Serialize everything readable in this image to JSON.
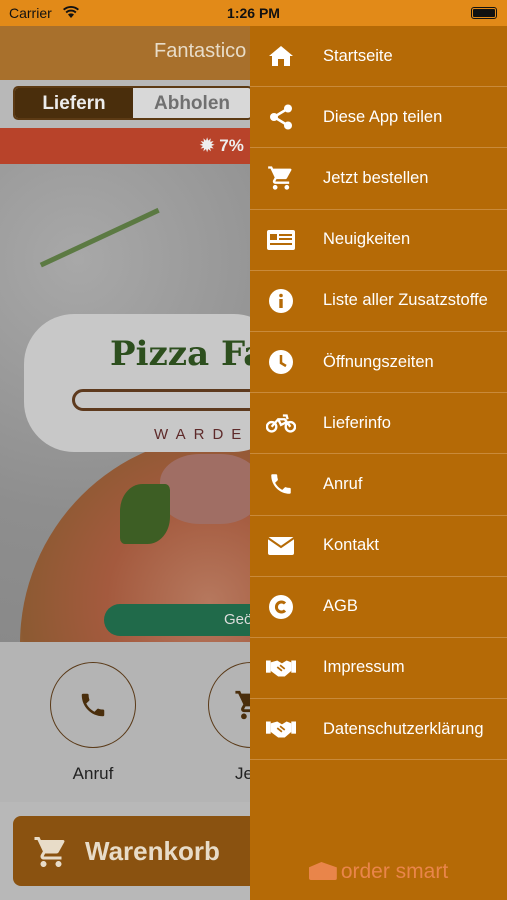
{
  "status_bar": {
    "carrier": "Carrier",
    "time": "1:26 PM"
  },
  "app": {
    "title": "Fantastico",
    "tabs": [
      {
        "label": "Liefern",
        "selected": true
      },
      {
        "label": "Abholen",
        "selected": false
      }
    ],
    "promo_text": "7%",
    "logo": {
      "title": "Pizza Fa",
      "subtitle": "WARDE"
    },
    "open_pill": "Geö",
    "actions": [
      {
        "label": "Anruf",
        "icon": "phone-icon"
      },
      {
        "label": "Jetzt b",
        "icon": "cart-icon"
      }
    ],
    "cart_button": "Warenkorb"
  },
  "drawer": {
    "items": [
      {
        "label": "Startseite",
        "icon": "home-icon"
      },
      {
        "label": "Diese App teilen",
        "icon": "share-icon"
      },
      {
        "label": "Jetzt bestellen",
        "icon": "cart-icon"
      },
      {
        "label": "Neuigkeiten",
        "icon": "news-icon"
      },
      {
        "label": "Liste aller Zusatzstoffe",
        "icon": "info-icon"
      },
      {
        "label": "Öffnungszeiten",
        "icon": "clock-icon"
      },
      {
        "label": "Lieferinfo",
        "icon": "motorcycle-icon"
      },
      {
        "label": "Anruf",
        "icon": "phone-icon"
      },
      {
        "label": "Kontakt",
        "icon": "envelope-icon"
      },
      {
        "label": "AGB",
        "icon": "copyright-icon"
      },
      {
        "label": "Impressum",
        "icon": "handshake-icon"
      },
      {
        "label": "Datenschutzerklärung",
        "icon": "handshake-icon"
      }
    ],
    "brand": "order smart"
  },
  "colors": {
    "drawer": "#b56a06",
    "accent": "#e28a18",
    "brand": "#e9854a",
    "open_green": "#206a4a"
  }
}
